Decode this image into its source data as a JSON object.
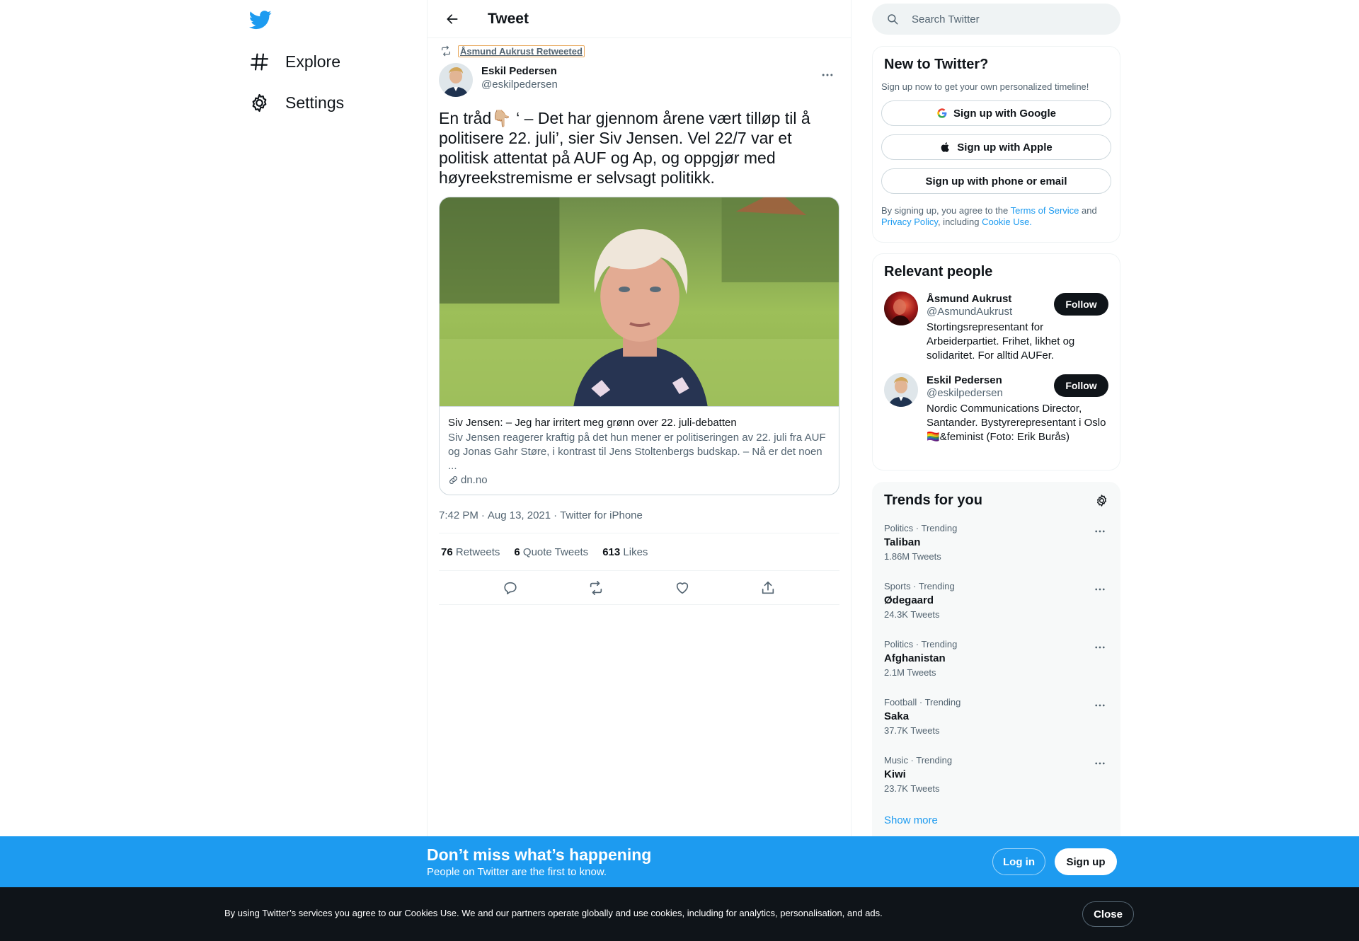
{
  "nav": {
    "items": [
      {
        "label": "Explore",
        "icon": "hashtag-icon"
      },
      {
        "label": "Settings",
        "icon": "gear-icon"
      }
    ]
  },
  "header": {
    "title": "Tweet"
  },
  "tweet": {
    "retweeted_by": "Åsmund Aukrust Retweeted",
    "author_name": "Eskil Pedersen",
    "author_handle": "@eskilpedersen",
    "text": "En tråd👇🏼 ‘ – Det har gjennom årene vært tilløp til å politisere 22. juli’, sier Siv Jensen. Vel 22/7 var et politisk attentat på AUF og Ap, og oppgjør med høyreekstremisme er selvsagt politikk.",
    "card": {
      "title": "Siv Jensen: – Jeg har irritert meg grønn over 22. juli-debatten",
      "description": "Siv Jensen reagerer kraftig på det hun mener er politiseringen av 22. juli fra AUF og Jonas Gahr Støre, i kontrast til Jens Stoltenbergs budskap. – Nå er det noen ...",
      "domain": "dn.no"
    },
    "time": "7:42 PM",
    "sep": "·",
    "date": "Aug 13, 2021",
    "source": "Twitter for iPhone",
    "stats": {
      "retweets_count": "76",
      "retweets_label": "Retweets",
      "quotes_count": "6",
      "quotes_label": "Quote Tweets",
      "likes_count": "613",
      "likes_label": "Likes"
    }
  },
  "search": {
    "placeholder": "Search Twitter"
  },
  "new_to_twitter": {
    "title": "New to Twitter?",
    "subtitle": "Sign up now to get your own personalized timeline!",
    "google": "Sign up with Google",
    "apple": "Sign up with Apple",
    "email": "Sign up with phone or email",
    "legal_1": "By signing up, you agree to the ",
    "terms": "Terms of Service",
    "legal_2": " and ",
    "privacy": "Privacy Policy",
    "legal_3": ", including ",
    "cookie": "Cookie Use."
  },
  "relevant_people": {
    "title": "Relevant people",
    "people": [
      {
        "name": "Åsmund Aukrust",
        "handle": "@AsmundAukrust",
        "bio": "Stortingsrepresentant for Arbeiderpartiet. Frihet, likhet og solidaritet. For alltid AUFer.",
        "follow": "Follow"
      },
      {
        "name": "Eskil Pedersen",
        "handle": "@eskilpedersen",
        "bio": "Nordic Communications Director, Santander. Bystyrerepresentant i Oslo 🏳️‍🌈&feminist (Foto: Erik Burås)",
        "follow": "Follow"
      }
    ]
  },
  "trends": {
    "title": "Trends for you",
    "items": [
      {
        "category": "Politics · Trending",
        "name": "Taliban",
        "count": "1.86M Tweets"
      },
      {
        "category": "Sports · Trending",
        "name": "Ødegaard",
        "count": "24.3K Tweets"
      },
      {
        "category": "Politics · Trending",
        "name": "Afghanistan",
        "count": "2.1M Tweets"
      },
      {
        "category": "Football · Trending",
        "name": "Saka",
        "count": "37.7K Tweets"
      },
      {
        "category": "Music · Trending",
        "name": "Kiwi",
        "count": "23.7K Tweets"
      }
    ],
    "show_more": "Show more"
  },
  "bottom_bar": {
    "title": "Don’t miss what’s happening",
    "subtitle": "People on Twitter are the first to know.",
    "login": "Log in",
    "signup": "Sign up"
  },
  "cookie_bar": {
    "text": "By using Twitter’s services you agree to our Cookies Use. We and our partners operate globally and use cookies, including for analytics, personalisation, and ads.",
    "close": "Close"
  },
  "colors": {
    "accent": "#1d9bf0",
    "text": "#0f1419",
    "muted": "#536471",
    "cookie_bg": "#0f1419"
  }
}
